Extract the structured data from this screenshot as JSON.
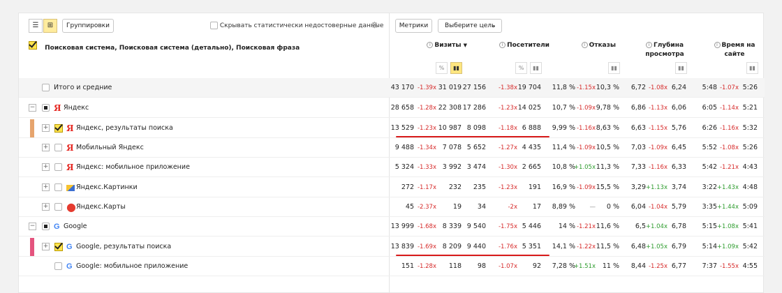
{
  "toolbar": {
    "groupings_label": "Группировки",
    "hide_unreliable_label": "Скрывать статистически недостоверные данные",
    "metrics_label": "Метрики",
    "goal_select_label": "Выберите цель"
  },
  "grouping_header": "Поисковая система, Поисковая система (детально), Поисковая фраза",
  "columns": {
    "visits": "Визиты",
    "visitors": "Посетители",
    "bounces": "Отказы",
    "depth_line1": "Глубина",
    "depth_line2": "просмотра",
    "time_line1": "Время на",
    "time_line2": "сайте"
  },
  "icons": {
    "list_view": "list-icon",
    "tree_view": "tree-icon",
    "settings": "gear-icon",
    "dropdown": "chevron-down-icon",
    "sort": "sort-desc-icon",
    "percent": "percent-icon",
    "bar_chart": "bar-chart-icon",
    "info": "info-icon"
  },
  "colors": {
    "accent_yellow": "#ffe34d",
    "negative": "#d62a2a",
    "positive": "#2e9c2e",
    "underline": "#d81a1a",
    "bar_orange": "#e6a46d",
    "bar_pink": "#e4547e"
  },
  "rows": [
    {
      "label": "Итого и средние",
      "visits": "43 170",
      "visits_d": "-1.39x",
      "visits_c": "31 019",
      "visitors": "27 156",
      "visitors_d": "-1.38x",
      "visitors_c": "19 704",
      "bounce": "11,8 %",
      "bounce_d": "-1.15x",
      "bounce_c": "10,3 %",
      "depth": "6,72",
      "depth_d": "-1.08x",
      "depth_c": "6,24",
      "time": "5:48",
      "time_d": "-1.07x",
      "time_c": "5:26"
    },
    {
      "label": "Яндекс",
      "visits": "28 658",
      "visits_d": "-1.28x",
      "visits_c": "22 308",
      "visitors": "17 286",
      "visitors_d": "-1.23x",
      "visitors_c": "14 025",
      "bounce": "10,7 %",
      "bounce_d": "-1.09x",
      "bounce_c": "9,78 %",
      "depth": "6,86",
      "depth_d": "-1.13x",
      "depth_c": "6,06",
      "time": "6:05",
      "time_d": "-1.14x",
      "time_c": "5:21"
    },
    {
      "label": "Яндекс, результаты поиска",
      "visits": "13 529",
      "visits_d": "-1.23x",
      "visits_c": "10 987",
      "visitors": "8 098",
      "visitors_d": "-1.18x",
      "visitors_c": "6 888",
      "bounce": "9,99 %",
      "bounce_d": "-1.16x",
      "bounce_c": "8,63 %",
      "depth": "6,63",
      "depth_d": "-1.15x",
      "depth_c": "5,76",
      "time": "6:26",
      "time_d": "-1.16x",
      "time_c": "5:32"
    },
    {
      "label": "Мобильный Яндекс",
      "visits": "9 488",
      "visits_d": "-1.34x",
      "visits_c": "7 078",
      "visitors": "5 652",
      "visitors_d": "-1.27x",
      "visitors_c": "4 435",
      "bounce": "11,4 %",
      "bounce_d": "-1.09x",
      "bounce_c": "10,5 %",
      "depth": "7,03",
      "depth_d": "-1.09x",
      "depth_c": "6,45",
      "time": "5:52",
      "time_d": "-1.08x",
      "time_c": "5:26"
    },
    {
      "label": "Яндекс: мобильное приложение",
      "visits": "5 324",
      "visits_d": "-1.33x",
      "visits_c": "3 992",
      "visitors": "3 474",
      "visitors_d": "-1.30x",
      "visitors_c": "2 665",
      "bounce": "10,8 %",
      "bounce_d": "+1.05x",
      "bounce_c": "11,3 %",
      "depth": "7,33",
      "depth_d": "-1.16x",
      "depth_c": "6,33",
      "time": "5:42",
      "time_d": "-1.21x",
      "time_c": "4:43"
    },
    {
      "label": "Яндекс.Картинки",
      "visits": "272",
      "visits_d": "-1.17x",
      "visits_c": "232",
      "visitors": "235",
      "visitors_d": "-1.23x",
      "visitors_c": "191",
      "bounce": "16,9 %",
      "bounce_d": "-1.09x",
      "bounce_c": "15,5 %",
      "depth": "3,29",
      "depth_d": "+1.13x",
      "depth_c": "3,74",
      "time": "3:22",
      "time_d": "+1.43x",
      "time_c": "4:48"
    },
    {
      "label": "Яндекс.Карты",
      "visits": "45",
      "visits_d": "-2.37x",
      "visits_c": "19",
      "visitors": "34",
      "visitors_d": "-2x",
      "visitors_c": "17",
      "bounce": "8,89 %",
      "bounce_d": "—",
      "bounce_c": "0 %",
      "depth": "6,04",
      "depth_d": "-1.04x",
      "depth_c": "5,79",
      "time": "3:35",
      "time_d": "+1.44x",
      "time_c": "5:09"
    },
    {
      "label": "Google",
      "visits": "13 999",
      "visits_d": "-1.68x",
      "visits_c": "8 339",
      "visitors": "9 540",
      "visitors_d": "-1.75x",
      "visitors_c": "5 446",
      "bounce": "14 %",
      "bounce_d": "-1.21x",
      "bounce_c": "11,6 %",
      "depth": "6,5",
      "depth_d": "+1.04x",
      "depth_c": "6,78",
      "time": "5:15",
      "time_d": "+1.08x",
      "time_c": "5:41"
    },
    {
      "label": "Google, результаты поиска",
      "visits": "13 839",
      "visits_d": "-1.69x",
      "visits_c": "8 209",
      "visitors": "9 440",
      "visitors_d": "-1.76x",
      "visitors_c": "5 351",
      "bounce": "14,1 %",
      "bounce_d": "-1.22x",
      "bounce_c": "11,5 %",
      "depth": "6,48",
      "depth_d": "+1.05x",
      "depth_c": "6,79",
      "time": "5:14",
      "time_d": "+1.09x",
      "time_c": "5:42"
    },
    {
      "label": "Google: мобильное приложение",
      "visits": "151",
      "visits_d": "-1.28x",
      "visits_c": "118",
      "visitors": "98",
      "visitors_d": "-1.07x",
      "visitors_c": "92",
      "bounce": "7,28 %",
      "bounce_d": "+1.51x",
      "bounce_c": "11 %",
      "depth": "8,44",
      "depth_d": "-1.25x",
      "depth_c": "6,77",
      "time": "7:37",
      "time_d": "-1.55x",
      "time_c": "4:55"
    }
  ]
}
